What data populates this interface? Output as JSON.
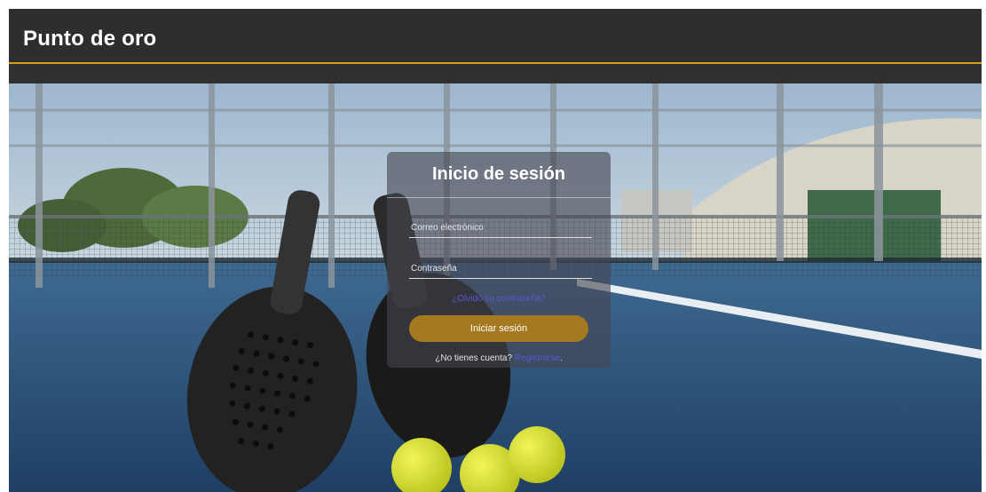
{
  "header": {
    "brand": "Punto de oro"
  },
  "login": {
    "title": "Inicio de sesión",
    "email_placeholder": "Correo electrónico",
    "password_placeholder": "Contraseña",
    "forgot_link": "¿Olvidó su contraseña?",
    "submit_label": "Iniciar sesión",
    "signup_prompt": "¿No tienes cuenta?",
    "signup_link": "Registrarse",
    "signup_suffix": "."
  },
  "colors": {
    "header_bg": "#2e2e2e",
    "accent_gold": "#d4a017",
    "button_gold": "#a47920",
    "link": "#5b57d8"
  }
}
